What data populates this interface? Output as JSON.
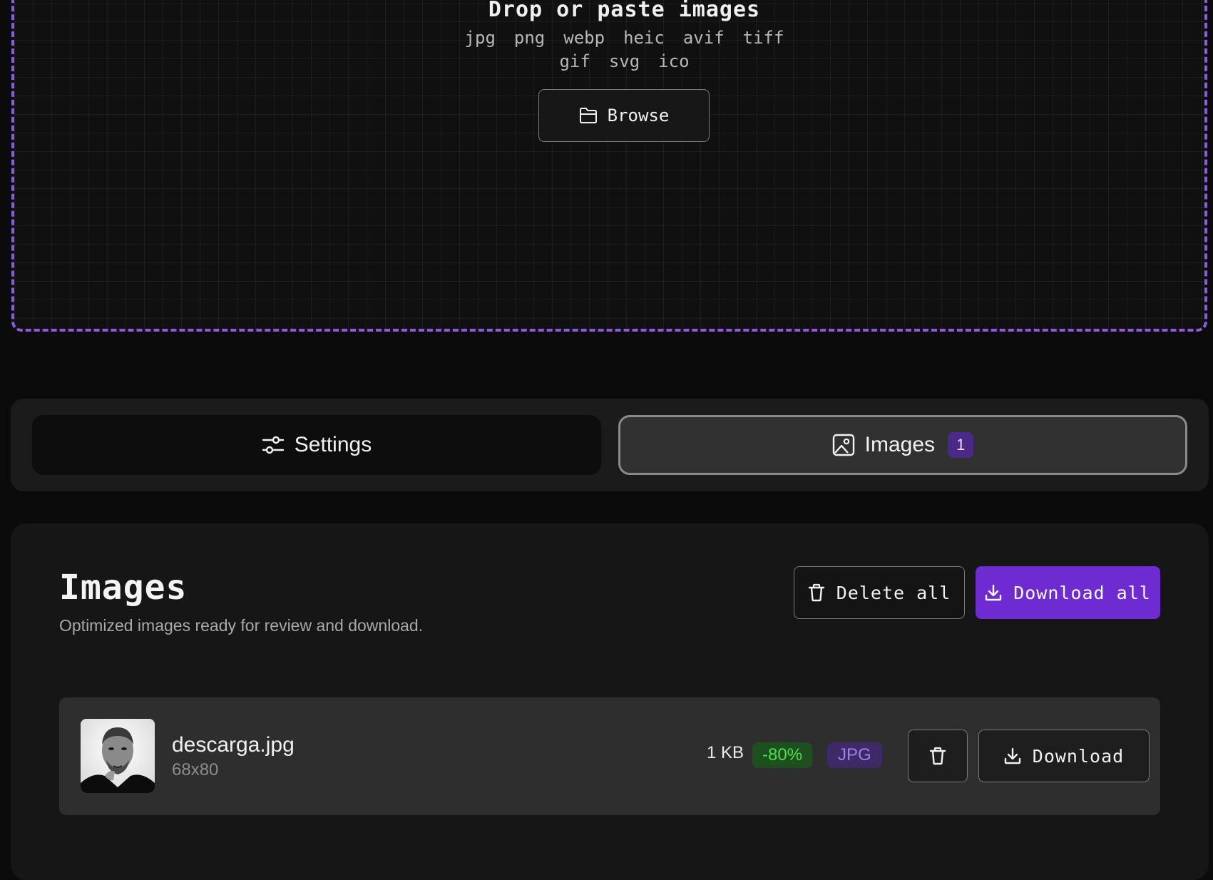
{
  "dropzone": {
    "title": "Drop or paste images",
    "formats_row1": [
      "jpg",
      "png",
      "webp",
      "heic",
      "avif",
      "tiff"
    ],
    "formats_row2": [
      "gif",
      "svg",
      "ico"
    ],
    "browse_label": "Browse",
    "accent_color": "#8e5ae0"
  },
  "tabs": {
    "settings_label": "Settings",
    "images_label": "Images",
    "images_count": "1"
  },
  "panel": {
    "title": "Images",
    "subtitle": "Optimized images ready for review and download.",
    "delete_all_label": "Delete all",
    "download_all_label": "Download all",
    "primary_color": "#6e2bd1"
  },
  "files": [
    {
      "name": "descarga.jpg",
      "dimensions": "68x80",
      "size": "1 KB",
      "savings": "-80%",
      "format": "JPG",
      "download_label": "Download"
    }
  ],
  "icons": {
    "upload": "image-upload-icon",
    "browse": "folder-icon",
    "settings": "sliders-icon",
    "images": "image-icon",
    "delete": "trash-icon",
    "download": "download-icon"
  }
}
